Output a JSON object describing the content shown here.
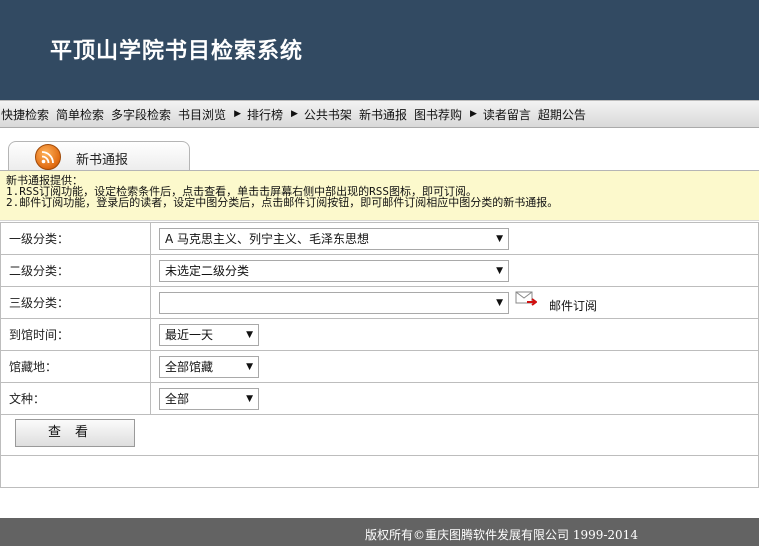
{
  "header": {
    "title": "平顶山学院书目检索系统"
  },
  "nav": {
    "items": [
      {
        "label": "快捷检索",
        "arrow": false
      },
      {
        "label": "简单检索",
        "arrow": false
      },
      {
        "label": "多字段检索",
        "arrow": false
      },
      {
        "label": "书目浏览",
        "arrow": true
      },
      {
        "label": "排行榜",
        "arrow": true
      },
      {
        "label": "公共书架",
        "arrow": false
      },
      {
        "label": "新书通报",
        "arrow": false
      },
      {
        "label": "图书荐购",
        "arrow": true
      },
      {
        "label": "读者留言",
        "arrow": false
      },
      {
        "label": "超期公告",
        "arrow": false
      }
    ]
  },
  "tab": {
    "label": "新书通报",
    "icon": "rss-icon"
  },
  "notice": {
    "line1": "新书通报提供：",
    "line2": "1.RSS订阅功能，设定检索条件后，点击查看，单击击屏幕右侧中部出现的RSS图标，即可订阅。",
    "line3": "2.邮件订阅功能，登录后的读者，设定中图分类后，点击邮件订阅按钮，即可邮件订阅相应中图分类的新书通报。"
  },
  "form": {
    "level1": {
      "label": "一级分类：",
      "value": "A 马克思主义、列宁主义、毛泽东思想"
    },
    "level2": {
      "label": "二级分类：",
      "value": "未选定二级分类"
    },
    "level3": {
      "label": "三级分类：",
      "value": ""
    },
    "mail_subscribe": "邮件订阅",
    "arrival": {
      "label": "到馆时间：",
      "value": "最近一天"
    },
    "location": {
      "label": "馆藏地：",
      "value": "全部馆藏"
    },
    "language": {
      "label": "文种：",
      "value": "全部"
    },
    "submit": "查看"
  },
  "footer": {
    "text": "版权所有©重庆图腾软件发展有限公司  1999-2014"
  },
  "colors": {
    "header_bg": "#324a62",
    "notice_bg": "#fcf9cc",
    "footer_bg": "#636363",
    "rss": "#e06a10"
  }
}
